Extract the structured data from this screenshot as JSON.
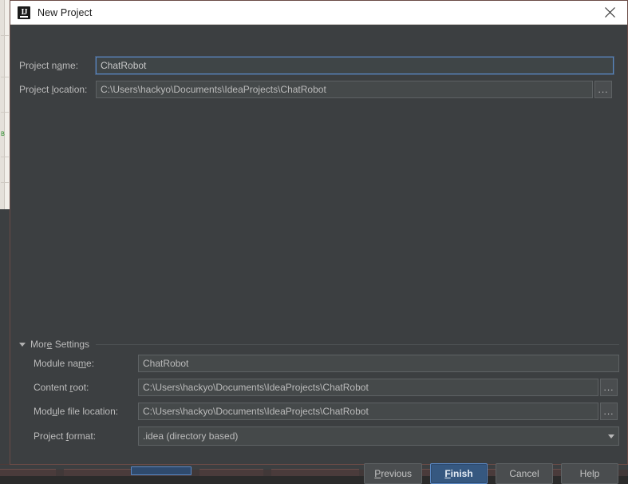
{
  "window": {
    "title": "New Project",
    "app_icon": "intellij-idea-icon",
    "close_icon": "close-icon"
  },
  "main": {
    "project_name": {
      "label_before": "Project n",
      "label_mnemonic": "a",
      "label_after": "me:",
      "value": "ChatRobot",
      "focused": true
    },
    "project_location": {
      "label_before": "Project ",
      "label_mnemonic": "l",
      "label_after": "ocation:",
      "value": "C:\\Users\\hackyo\\Documents\\IdeaProjects\\ChatRobot",
      "browse_label": "..."
    }
  },
  "more_settings": {
    "expanded": true,
    "toggle_icon": "chevron-down-icon",
    "label_before": "Mor",
    "label_mnemonic": "e",
    "label_after": " Settings",
    "module_name": {
      "label_before": "Module na",
      "label_mnemonic": "m",
      "label_after": "e:",
      "value": "ChatRobot"
    },
    "content_root": {
      "label_before": "Content ",
      "label_mnemonic": "r",
      "label_after": "oot:",
      "value": "C:\\Users\\hackyo\\Documents\\IdeaProjects\\ChatRobot",
      "browse_label": "..."
    },
    "module_file_location": {
      "label_before": "Mod",
      "label_mnemonic": "u",
      "label_after": "le file location:",
      "value": "C:\\Users\\hackyo\\Documents\\IdeaProjects\\ChatRobot",
      "browse_label": "..."
    },
    "project_format": {
      "label_before": "Project ",
      "label_mnemonic": "f",
      "label_after": "ormat:",
      "value": ".idea (directory based)",
      "arrow_icon": "chevron-down-icon"
    }
  },
  "buttons": {
    "previous": {
      "before": "",
      "mnemonic": "P",
      "after": "revious"
    },
    "finish": {
      "before": "",
      "mnemonic": "F",
      "after": "inish",
      "default": true
    },
    "cancel": {
      "before": "Cancel",
      "mnemonic": "",
      "after": ""
    },
    "help": {
      "before": "Help",
      "mnemonic": "",
      "after": ""
    }
  },
  "colors": {
    "dialog_background": "#3c3f41",
    "titlebar_background": "#ffffff",
    "field_background": "#45494a",
    "text": "#bbbbbb",
    "accent_focus": "#5a87c2",
    "default_button": "#365880"
  }
}
